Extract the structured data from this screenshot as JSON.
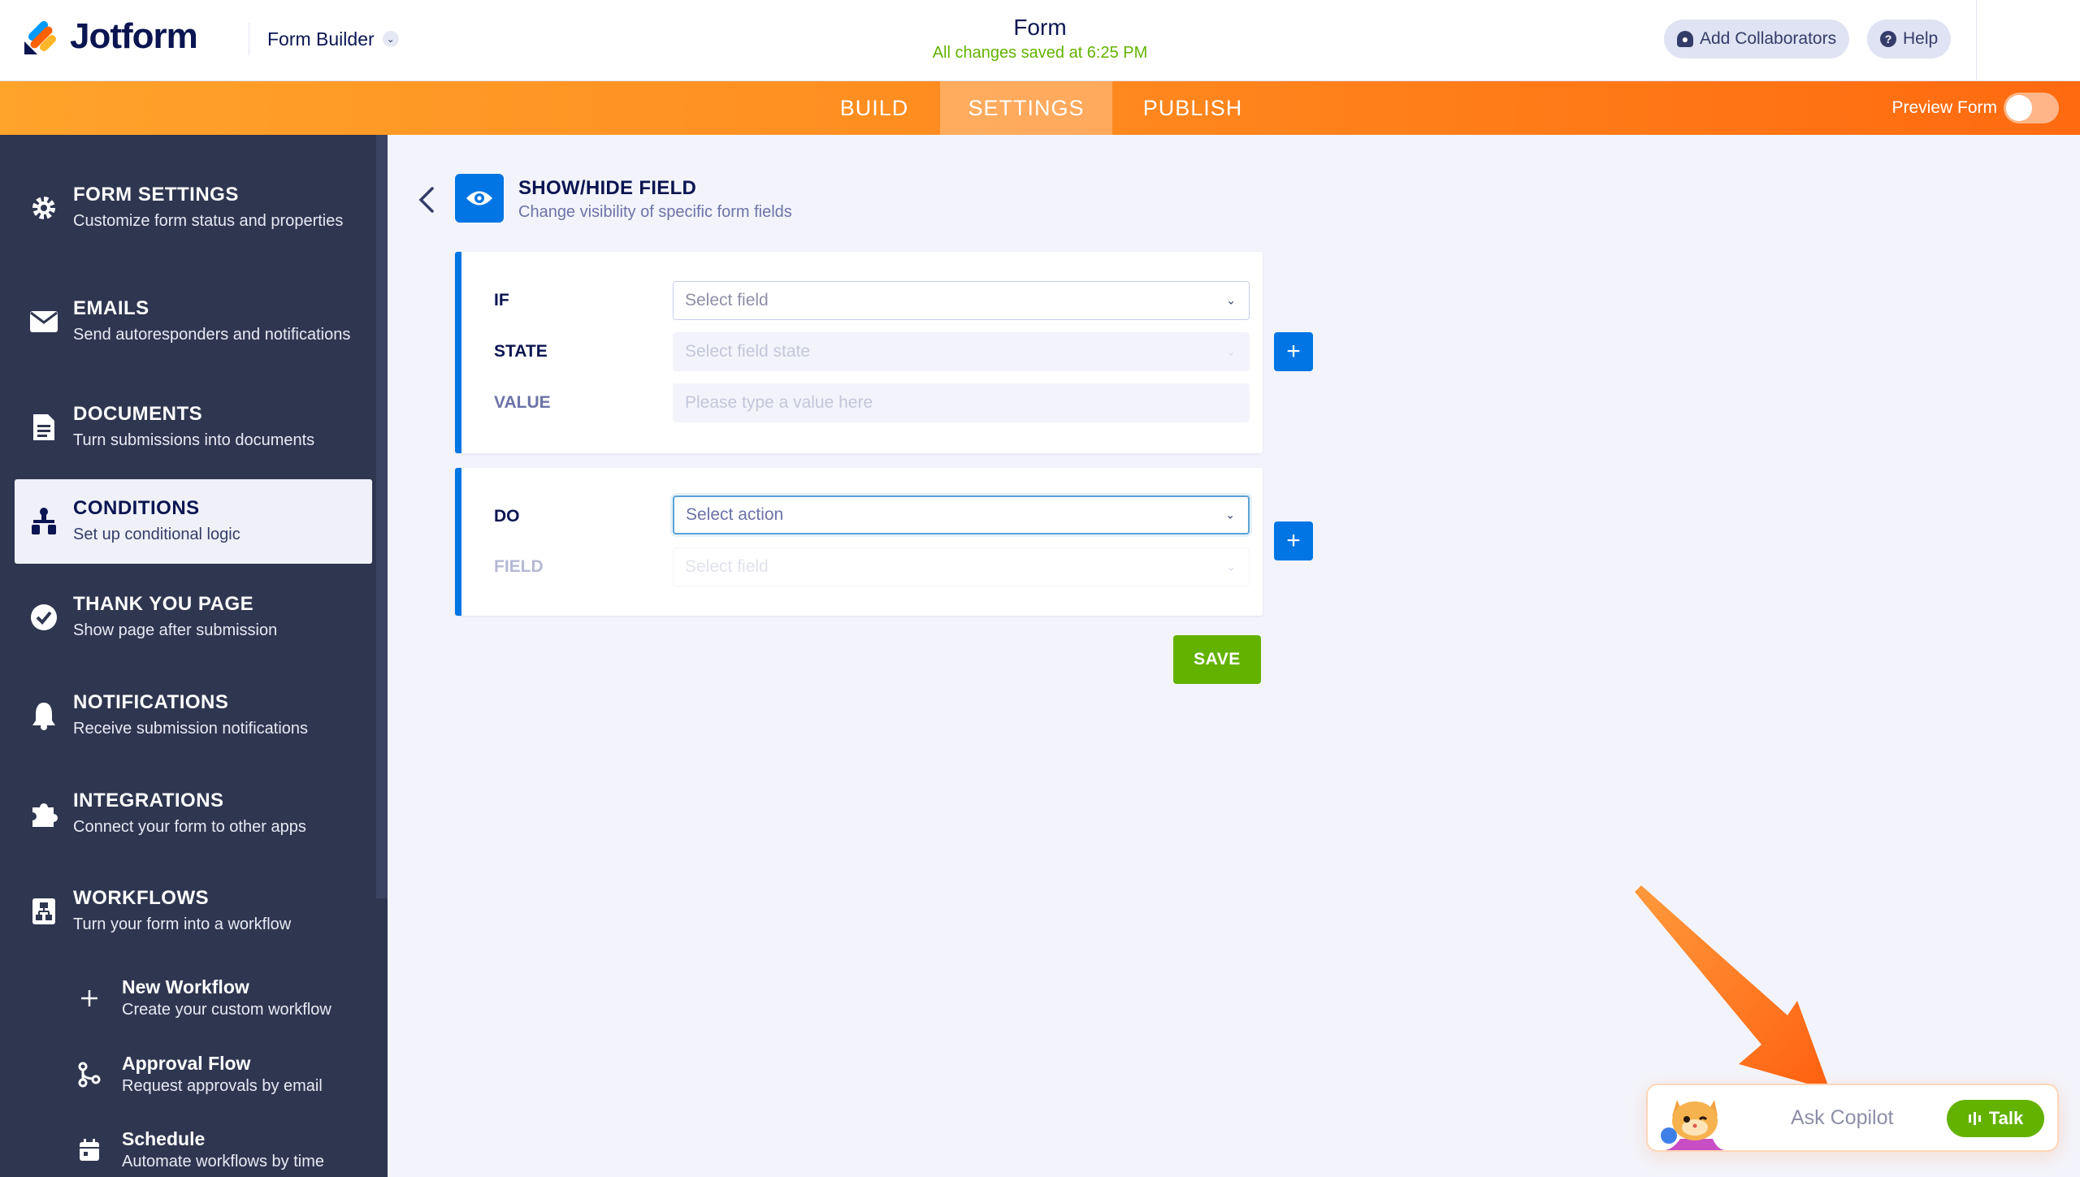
{
  "header": {
    "logo_text": "Jotform",
    "builder_label": "Form Builder",
    "form_title": "Form",
    "saved_status": "All changes saved at 6:25 PM",
    "add_collaborators": "Add Collaborators",
    "help": "Help"
  },
  "nav": {
    "tabs": [
      {
        "label": "BUILD",
        "active": false
      },
      {
        "label": "SETTINGS",
        "active": true
      },
      {
        "label": "PUBLISH",
        "active": false
      }
    ],
    "preview_label": "Preview Form",
    "preview_on": false
  },
  "sidebar": {
    "items": [
      {
        "title": "FORM SETTINGS",
        "subtitle": "Customize form status and properties",
        "icon": "gear-icon"
      },
      {
        "title": "EMAILS",
        "subtitle": "Send autoresponders and notifications",
        "icon": "envelope-icon"
      },
      {
        "title": "DOCUMENTS",
        "subtitle": "Turn submissions into documents",
        "icon": "document-icon"
      },
      {
        "title": "CONDITIONS",
        "subtitle": "Set up conditional logic",
        "icon": "hierarchy-icon",
        "active": true
      },
      {
        "title": "THANK YOU PAGE",
        "subtitle": "Show page after submission",
        "icon": "check-circle-icon"
      },
      {
        "title": "NOTIFICATIONS",
        "subtitle": "Receive submission notifications",
        "icon": "bell-icon"
      },
      {
        "title": "INTEGRATIONS",
        "subtitle": "Connect your form to other apps",
        "icon": "puzzle-icon"
      },
      {
        "title": "WORKFLOWS",
        "subtitle": "Turn your form into a workflow",
        "icon": "workflow-icon"
      }
    ],
    "workflow_subitems": [
      {
        "title": "New Workflow",
        "subtitle": "Create your custom workflow",
        "icon": "plus-icon"
      },
      {
        "title": "Approval Flow",
        "subtitle": "Request approvals by email",
        "icon": "approval-flow-icon"
      },
      {
        "title": "Schedule",
        "subtitle": "Automate workflows by time",
        "icon": "calendar-icon"
      }
    ]
  },
  "main": {
    "title": "SHOW/HIDE FIELD",
    "subtitle": "Change visibility of specific form fields",
    "if_block": {
      "if_label": "IF",
      "if_placeholder": "Select field",
      "state_label": "STATE",
      "state_placeholder": "Select field state",
      "value_label": "VALUE",
      "value_placeholder": "Please type a value here"
    },
    "do_block": {
      "do_label": "DO",
      "do_placeholder": "Select action",
      "field_label": "FIELD",
      "field_placeholder": "Select field"
    },
    "add_symbol": "+",
    "save_label": "SAVE"
  },
  "copilot": {
    "placeholder": "Ask Copilot",
    "talk_label": "Talk"
  },
  "colors": {
    "accent_blue": "#0075e3",
    "green": "#64b200",
    "orange": "#ff8a1f",
    "sidebar": "#2f3650"
  }
}
